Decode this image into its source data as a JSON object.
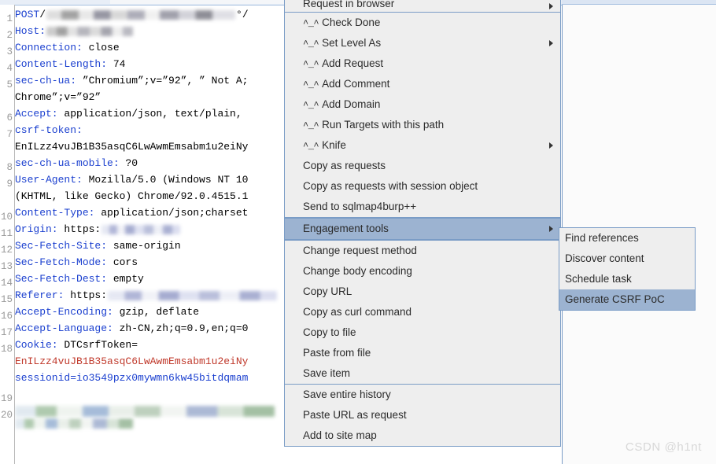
{
  "editor": {
    "gutter_numbers": [
      "1",
      "2",
      "3",
      "4",
      "5",
      "6",
      "7",
      "8",
      "9",
      "10",
      "11",
      "12",
      "13",
      "14",
      "15",
      "16",
      "17",
      "18",
      "19",
      "20"
    ],
    "lines": [
      {
        "n": "1",
        "key": "POST",
        "value": "/",
        "redacted": true,
        "tail": "°/"
      },
      {
        "n": "2",
        "key": "Host:",
        "value": "",
        "redacted": true
      },
      {
        "n": "3",
        "key": "Connection:",
        "value": " close"
      },
      {
        "n": "4",
        "key": "Content-Length:",
        "value": " 74"
      },
      {
        "n": "5",
        "key": "sec-ch-ua:",
        "value": " ”Chromium”;v=”92”, ” Not A;"
      },
      {
        "n": "",
        "key": "",
        "value": "Chrome”;v=”92”",
        "cont": true
      },
      {
        "n": "6",
        "key": "Accept:",
        "value": " application/json, text/plain,"
      },
      {
        "n": "7",
        "key": "csrf-token:",
        "value": ""
      },
      {
        "n": "",
        "key": "",
        "value": "EnILzz4vuJB1B35asqC6LwAwmEmsabm1u2eiNy",
        "cont": true
      },
      {
        "n": "8",
        "key": "sec-ch-ua-mobile:",
        "value": " ?0"
      },
      {
        "n": "9",
        "key": "User-Agent:",
        "value": " Mozilla/5.0 (Windows NT 10"
      },
      {
        "n": "",
        "key": "",
        "value": "(KHTML, like Gecko) Chrome/92.0.4515.1",
        "cont": true
      },
      {
        "n": "10",
        "key": "Content-Type:",
        "value": " application/json;charset"
      },
      {
        "n": "11",
        "key": "Origin:",
        "value": " https:",
        "redacted": true
      },
      {
        "n": "12",
        "key": "Sec-Fetch-Site:",
        "value": " same-origin"
      },
      {
        "n": "13",
        "key": "Sec-Fetch-Mode:",
        "value": " cors"
      },
      {
        "n": "14",
        "key": "Sec-Fetch-Dest:",
        "value": " empty"
      },
      {
        "n": "15",
        "key": "Referer:",
        "value": " https:",
        "redacted": true
      },
      {
        "n": "16",
        "key": "Accept-Encoding:",
        "value": " gzip, deflate"
      },
      {
        "n": "17",
        "key": "Accept-Language:",
        "value": " zh-CN,zh;q=0.9,en;q=0"
      },
      {
        "n": "18",
        "key": "Cookie:",
        "value": " DTCsrfToken="
      },
      {
        "n": "",
        "key": "",
        "value": "EnILzz4vuJB1B35asqC6LwAwmEmsabm1u2eiNy",
        "cont": true,
        "color": "red"
      },
      {
        "n": "",
        "key": "",
        "value": "sessionid=io3549pzx0mywmn6kw45bitdqmam",
        "cont": true,
        "color": "blue"
      },
      {
        "n": "19",
        "key": "",
        "value": ""
      },
      {
        "n": "20",
        "key": "",
        "value": "",
        "redacted": true,
        "body": true
      }
    ]
  },
  "context_menu": {
    "items": [
      {
        "label": "Request in browser",
        "submenu": true,
        "partial": true
      },
      {
        "sep": true
      },
      {
        "label": "Check Done",
        "prefix": "^_^",
        "submenu": false
      },
      {
        "label": "Set Level As",
        "prefix": "^_^",
        "submenu": true
      },
      {
        "label": "Add Request",
        "prefix": "^_^",
        "submenu": false
      },
      {
        "label": "Add Comment",
        "prefix": "^_^",
        "submenu": false
      },
      {
        "label": "Add Domain",
        "prefix": "^_^",
        "submenu": false
      },
      {
        "label": "Run Targets with this path",
        "prefix": "^_^",
        "submenu": false
      },
      {
        "label": "Knife",
        "prefix": "^_^",
        "submenu": true
      },
      {
        "label": "Copy as requests",
        "submenu": false
      },
      {
        "label": "Copy as requests with session object",
        "submenu": false
      },
      {
        "label": "Send to sqlmap4burp++",
        "submenu": false
      },
      {
        "sep": true
      },
      {
        "label": "Engagement tools",
        "submenu": true,
        "selected": true
      },
      {
        "sep": true
      },
      {
        "label": "Change request method",
        "submenu": false
      },
      {
        "label": "Change body encoding",
        "submenu": false
      },
      {
        "label": "Copy URL",
        "submenu": false
      },
      {
        "label": "Copy as curl command",
        "submenu": false
      },
      {
        "label": "Copy to file",
        "submenu": false
      },
      {
        "label": "Paste from file",
        "submenu": false
      },
      {
        "label": "Save item",
        "submenu": false
      },
      {
        "sep": true
      },
      {
        "label": "Save entire history",
        "submenu": false
      },
      {
        "label": "Paste URL as request",
        "submenu": false
      },
      {
        "label": "Add to site map",
        "submenu": false
      }
    ]
  },
  "submenu": {
    "items": [
      {
        "label": "Find references",
        "selected": false
      },
      {
        "label": "Discover content",
        "selected": false
      },
      {
        "label": "Schedule task",
        "selected": false
      },
      {
        "label": "Generate CSRF PoC",
        "selected": true
      }
    ]
  },
  "watermark": {
    "text": "CSDN @h1nt"
  },
  "colors": {
    "menu_bg": "#eeeeee",
    "menu_border": "#7a9cc6",
    "selection": "#9cb3d1",
    "header_key": "#1a3fcf",
    "cookie_red": "#c0392b",
    "gutter_text": "#999999"
  }
}
